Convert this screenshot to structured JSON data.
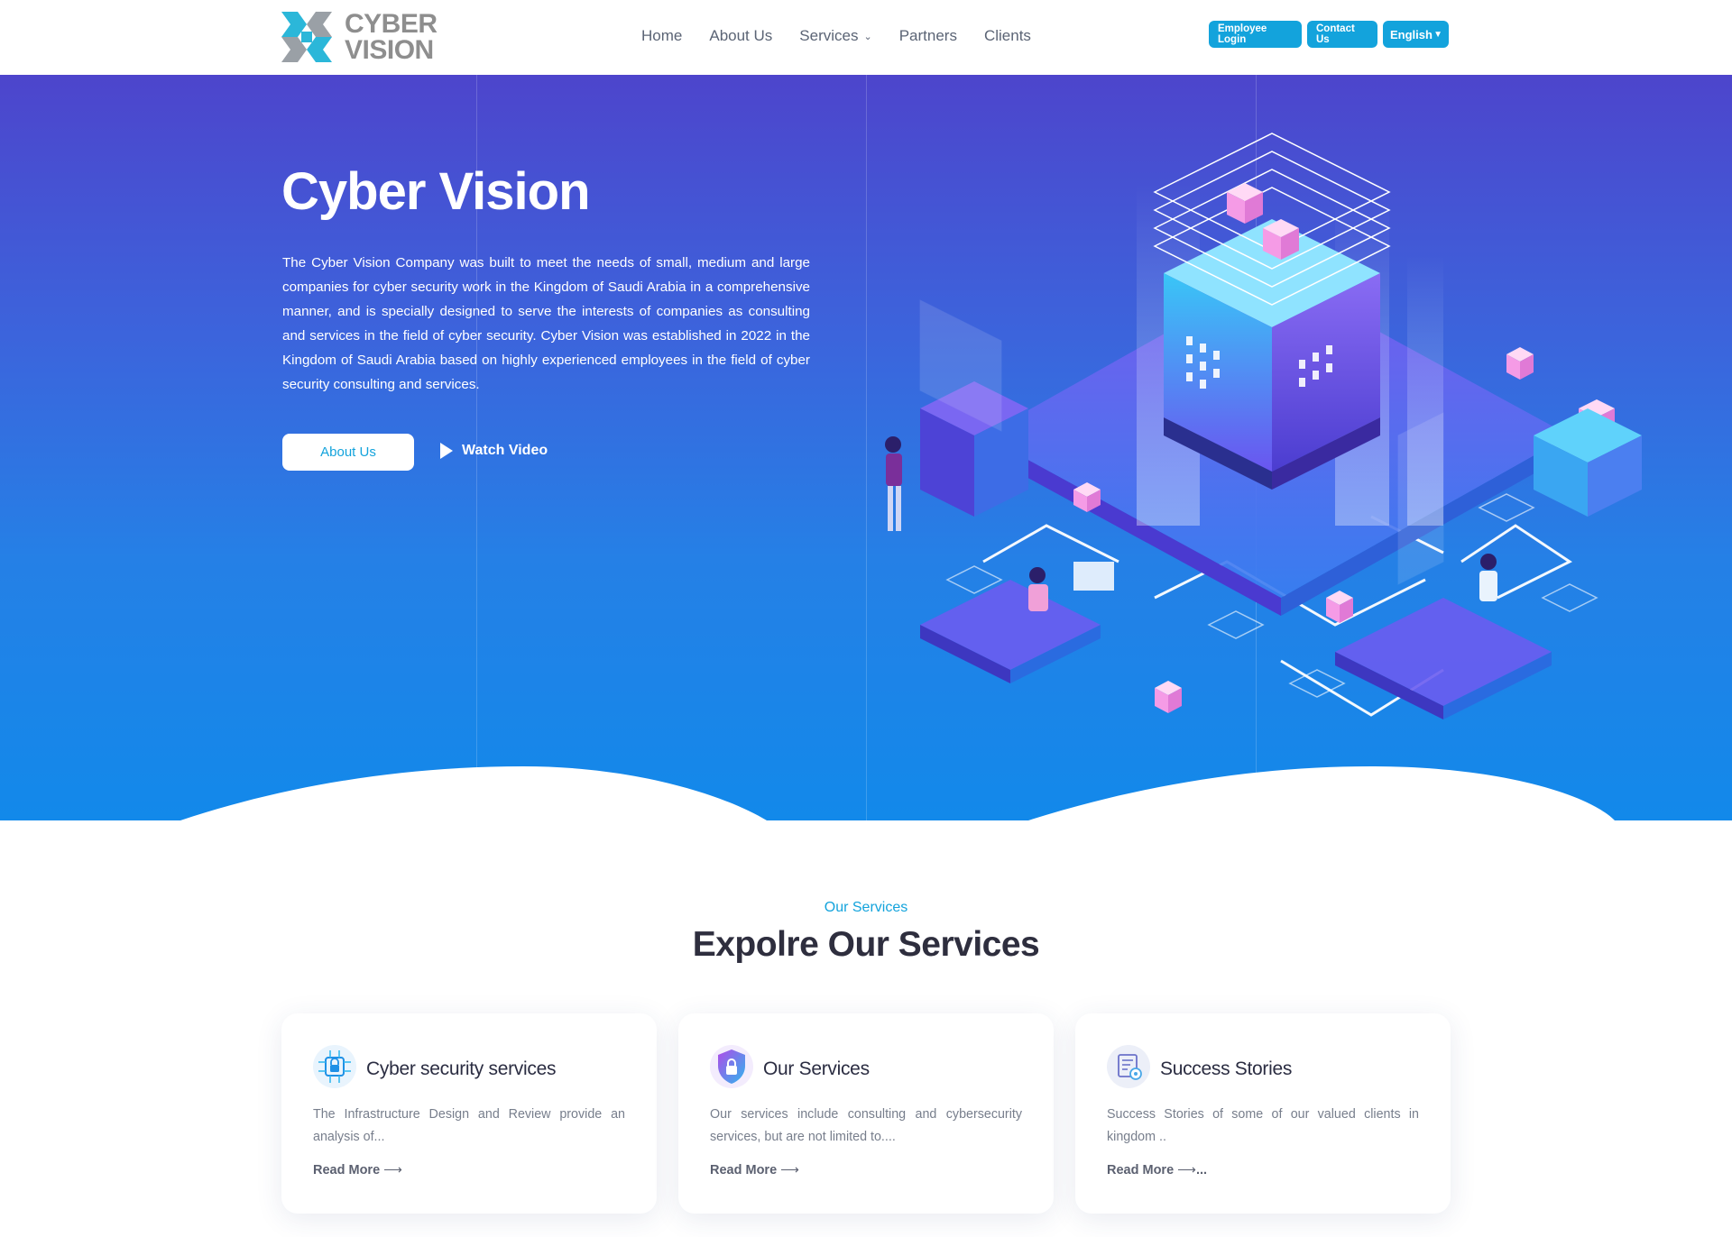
{
  "header": {
    "logo": {
      "line1": "CYBER",
      "line2": "VISION"
    },
    "nav": [
      {
        "label": "Home"
      },
      {
        "label": "About Us"
      },
      {
        "label": "Services"
      },
      {
        "label": "Partners"
      },
      {
        "label": "Clients"
      }
    ],
    "employee_login": "Employee Login",
    "contact_us": "Contact Us",
    "language": "English"
  },
  "hero": {
    "title": "Cyber Vision",
    "description": "The Cyber Vision Company was built to meet the needs of small, medium and large companies for cyber security work in the Kingdom of Saudi Arabia in a comprehensive manner, and is specially designed to serve the interests of companies as consulting and services in the field of cyber security. Cyber Vision was established in 2022 in the Kingdom of Saudi Arabia based on highly experienced employees in the field of cyber security consulting and services.",
    "about_button": "About Us",
    "watch_video": "Watch Video"
  },
  "services": {
    "kicker": "Our Services",
    "title": "Expolre Our Services",
    "cards": [
      {
        "icon": "circuit-lock-icon",
        "title": "Cyber security services",
        "description": "The Infrastructure Design and Review provide an analysis of...",
        "link": "Read More"
      },
      {
        "icon": "shield-lock-icon",
        "title": "Our Services",
        "description": "Our services include consulting and cybersecurity services, but are not limited to....",
        "link": "Read More"
      },
      {
        "icon": "report-gear-icon",
        "title": "Success Stories",
        "description": "Success Stories of some of our valued clients in kingdom ..",
        "link": "Read More",
        "link_suffix": "..."
      }
    ]
  },
  "colors": {
    "accent": "#13a3dc",
    "hero_top": "#4d45cc",
    "hero_bottom": "#1289ea"
  }
}
